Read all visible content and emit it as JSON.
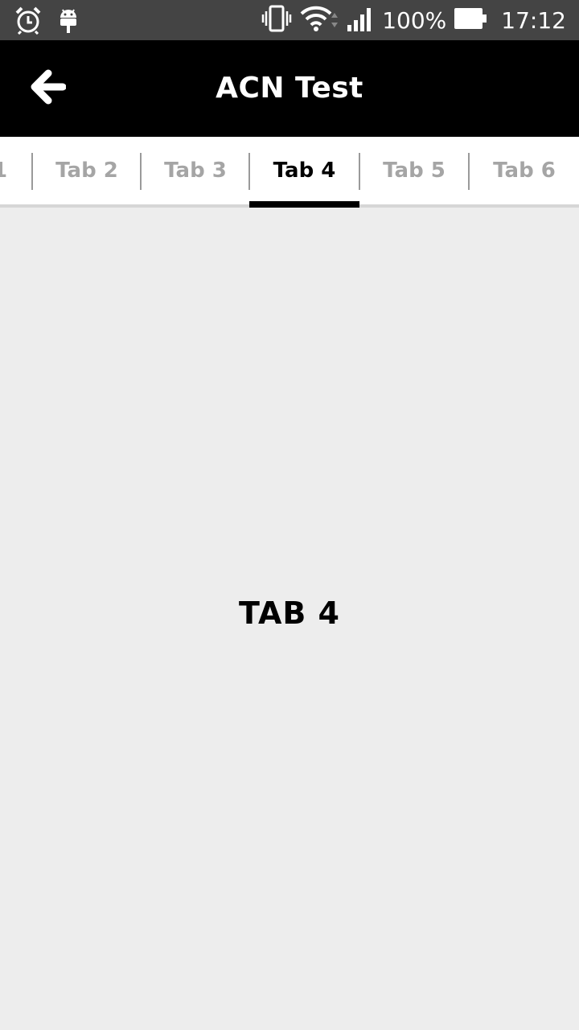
{
  "status_bar": {
    "icons_left": [
      "alarm-icon",
      "android-icon"
    ],
    "icons_right": [
      "vibrate-icon",
      "wifi-icon",
      "signal-icon",
      "battery-icon"
    ],
    "battery_text": "100%",
    "time": "17:12"
  },
  "app_bar": {
    "back_icon": "arrow-left-icon",
    "title": "ACN Test"
  },
  "tabs": [
    {
      "label": "1",
      "active": false
    },
    {
      "label": "Tab 2",
      "active": false
    },
    {
      "label": "Tab 3",
      "active": false
    },
    {
      "label": "Tab 4",
      "active": true
    },
    {
      "label": "Tab 5",
      "active": false
    },
    {
      "label": "Tab 6",
      "active": false
    }
  ],
  "content": {
    "label": "TAB 4"
  },
  "colors": {
    "status_bar": "#444444",
    "app_bar": "#000000",
    "tab_inactive": "#a5a5a5",
    "tab_active": "#000000",
    "background": "#ededed"
  }
}
